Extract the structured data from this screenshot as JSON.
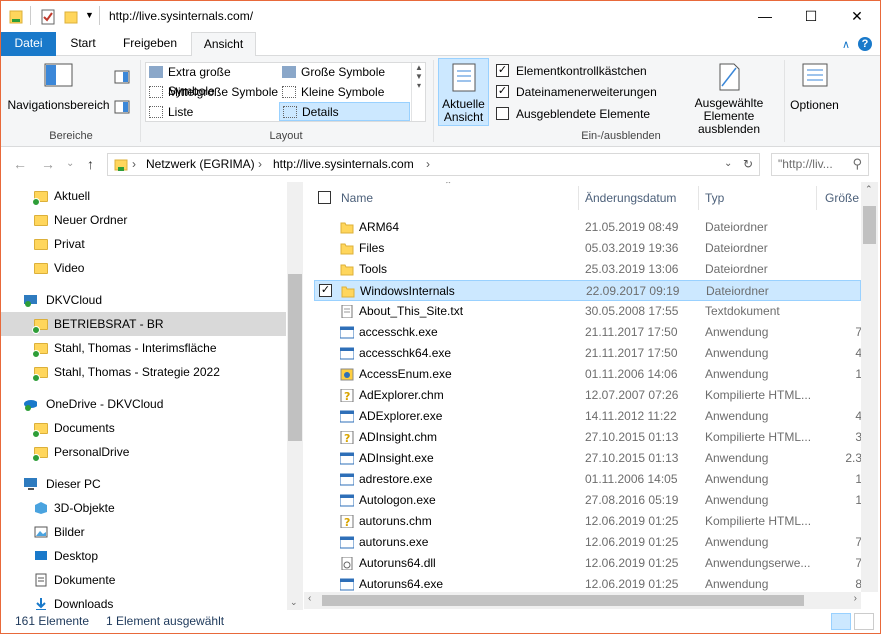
{
  "window": {
    "title": "http://live.sysinternals.com/"
  },
  "tabs": [
    {
      "label": "Datei"
    },
    {
      "label": "Start"
    },
    {
      "label": "Freigeben"
    },
    {
      "label": "Ansicht"
    }
  ],
  "ribbon": {
    "nav_pane_label": "Navigationsbereich",
    "group_bereiche": "Bereiche",
    "group_layout": "Layout",
    "group_einaus": "Ein-/ausblenden",
    "layout_items": [
      "Extra große Symbole",
      "Große Symbole",
      "Mittelgroße Symbole",
      "Kleine Symbole",
      "Liste",
      "Details"
    ],
    "current_view": "Aktuelle\nAnsicht",
    "current_view_l1": "Aktuelle",
    "current_view_l2": "Ansicht",
    "checks": [
      {
        "label": "Elementkontrollkästchen",
        "checked": true
      },
      {
        "label": "Dateinamenerweiterungen",
        "checked": true
      },
      {
        "label": "Ausgeblendete Elemente",
        "checked": false
      }
    ],
    "hide_selected_l1": "Ausgewählte",
    "hide_selected_l2": "Elemente ausblenden",
    "options": "Optionen"
  },
  "address": {
    "crumbs": [
      "Netzwerk (EGRIMA)",
      "http://live.sysinternals.com"
    ],
    "search_placeholder": "\"http://liv..."
  },
  "nav": [
    {
      "label": "Aktuell",
      "icon": "folder-icon"
    },
    {
      "label": "Neuer Ordner",
      "icon": "folder-icon"
    },
    {
      "label": "Privat",
      "icon": "folder-icon"
    },
    {
      "label": "Video",
      "icon": "folder-icon"
    },
    {
      "label": "DKVCloud",
      "icon": "cloud-icon"
    },
    {
      "label": "BETRIEBSRAT - BR",
      "icon": "folder-icon"
    },
    {
      "label": "Stahl, Thomas - Interimsfläche",
      "icon": "folder-icon"
    },
    {
      "label": "Stahl, Thomas - Strategie 2022",
      "icon": "folder-icon"
    },
    {
      "label": "OneDrive - DKVCloud",
      "icon": "onedrive-icon"
    },
    {
      "label": "Documents",
      "icon": "folder-icon"
    },
    {
      "label": "PersonalDrive",
      "icon": "folder-icon"
    },
    {
      "label": "Dieser PC",
      "icon": "pc-icon"
    },
    {
      "label": "3D-Objekte",
      "icon": "3d-objects-icon"
    },
    {
      "label": "Bilder",
      "icon": "pictures-icon"
    },
    {
      "label": "Desktop",
      "icon": "desktop-icon"
    },
    {
      "label": "Dokumente",
      "icon": "documents-icon"
    },
    {
      "label": "Downloads",
      "icon": "downloads-icon"
    }
  ],
  "columns": {
    "name": "Name",
    "date": "Änderungsdatum",
    "type": "Typ",
    "size": "Größe"
  },
  "files": [
    {
      "name": "ARM64",
      "date": "21.05.2019 08:49",
      "type": "Dateiordner",
      "size": "",
      "icon": "folder-icon"
    },
    {
      "name": "Files",
      "date": "05.03.2019 19:36",
      "type": "Dateiordner",
      "size": "",
      "icon": "folder-icon"
    },
    {
      "name": "Tools",
      "date": "25.03.2019 13:06",
      "type": "Dateiordner",
      "size": "",
      "icon": "folder-icon"
    },
    {
      "name": "WindowsInternals",
      "date": "22.09.2017 09:19",
      "type": "Dateiordner",
      "size": "",
      "icon": "folder-icon",
      "selected": true
    },
    {
      "name": "About_This_Site.txt",
      "date": "30.05.2008 17:55",
      "type": "Textdokument",
      "size": "",
      "icon": "text-file-icon"
    },
    {
      "name": "accesschk.exe",
      "date": "21.11.2017 17:50",
      "type": "Anwendung",
      "size": "7",
      "icon": "exe-icon"
    },
    {
      "name": "accesschk64.exe",
      "date": "21.11.2017 17:50",
      "type": "Anwendung",
      "size": "4",
      "icon": "exe-icon"
    },
    {
      "name": "AccessEnum.exe",
      "date": "01.11.2006 14:06",
      "type": "Anwendung",
      "size": "1",
      "icon": "app-icon"
    },
    {
      "name": "AdExplorer.chm",
      "date": "12.07.2007 07:26",
      "type": "Kompilierte HTML...",
      "size": "",
      "icon": "help-icon"
    },
    {
      "name": "ADExplorer.exe",
      "date": "14.11.2012 11:22",
      "type": "Anwendung",
      "size": "4",
      "icon": "exe-icon"
    },
    {
      "name": "ADInsight.chm",
      "date": "27.10.2015 01:13",
      "type": "Kompilierte HTML...",
      "size": "3",
      "icon": "help-icon"
    },
    {
      "name": "ADInsight.exe",
      "date": "27.10.2015 01:13",
      "type": "Anwendung",
      "size": "2.3",
      "icon": "exe-icon"
    },
    {
      "name": "adrestore.exe",
      "date": "01.11.2006 14:05",
      "type": "Anwendung",
      "size": "1",
      "icon": "exe-icon"
    },
    {
      "name": "Autologon.exe",
      "date": "27.08.2016 05:19",
      "type": "Anwendung",
      "size": "1",
      "icon": "exe-icon"
    },
    {
      "name": "autoruns.chm",
      "date": "12.06.2019 01:25",
      "type": "Kompilierte HTML...",
      "size": "",
      "icon": "help-icon"
    },
    {
      "name": "autoruns.exe",
      "date": "12.06.2019 01:25",
      "type": "Anwendung",
      "size": "7",
      "icon": "exe-icon"
    },
    {
      "name": "Autoruns64.dll",
      "date": "12.06.2019 01:25",
      "type": "Anwendungserwe...",
      "size": "7",
      "icon": "dll-icon"
    },
    {
      "name": "Autoruns64.exe",
      "date": "12.06.2019 01:25",
      "type": "Anwendung",
      "size": "8",
      "icon": "exe-icon"
    }
  ],
  "status": {
    "count": "161 Elemente",
    "selected": "1 Element ausgewählt"
  },
  "colors": {
    "accent": "#1979ca",
    "selection": "#cce8ff",
    "frame": "#e8693a"
  }
}
